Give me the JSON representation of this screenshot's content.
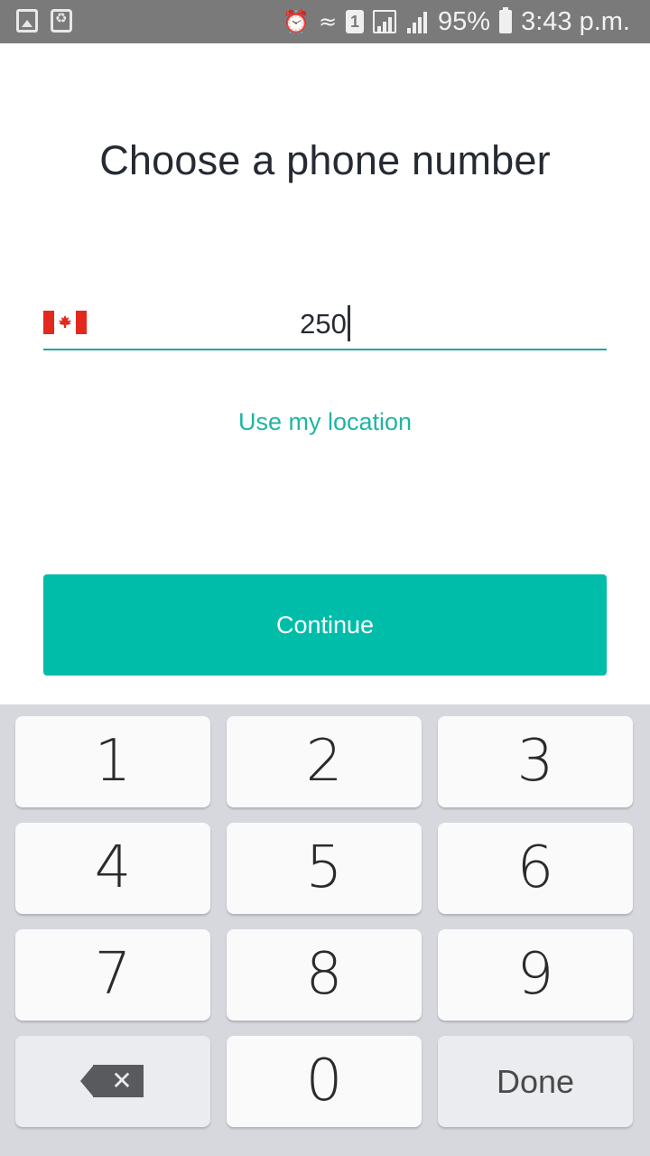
{
  "status_bar": {
    "icons_left": [
      "gallery-icon",
      "recycle-battery-icon"
    ],
    "icons_right": [
      "alarm-icon",
      "wifi-icon",
      "sim-icon",
      "signal-icon",
      "signal-icon",
      "battery-icon"
    ],
    "sim_label": "1",
    "battery": "95%",
    "time": "3:43 p.m."
  },
  "title": "Choose a phone number",
  "phone_field": {
    "country_flag": "canada-flag-icon",
    "value": "250"
  },
  "use_location_label": "Use my location",
  "continue_label": "Continue",
  "keypad": {
    "k1": "1",
    "k2": "2",
    "k3": "3",
    "k4": "4",
    "k5": "5",
    "k6": "6",
    "k7": "7",
    "k8": "8",
    "k9": "9",
    "k0": "0",
    "backspace": "backspace-icon",
    "done": "Done"
  },
  "colors": {
    "accent": "#00bdaa",
    "link": "#1eb5a4",
    "status_bar": "#7a7a7a",
    "keyboard_bg": "#d6d8de"
  }
}
